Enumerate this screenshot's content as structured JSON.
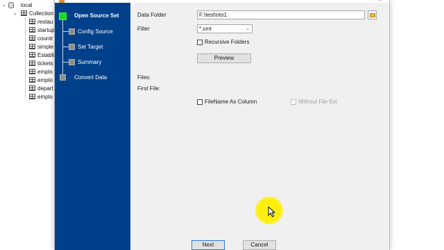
{
  "tree": {
    "root_label": "local",
    "collections_label": "Collection",
    "items": [
      "restau",
      "startup",
      "countr",
      "simple",
      "Establi",
      "tickets",
      "emplo",
      "emplo",
      "depart",
      "emplo"
    ]
  },
  "dialog": {
    "close_glyph": "×"
  },
  "wizard": {
    "steps": [
      {
        "label": "Open Source Set",
        "active": true
      },
      {
        "label": "Config Source",
        "active": false
      },
      {
        "label": "Set Target",
        "active": false
      },
      {
        "label": "Summary",
        "active": false
      },
      {
        "label": "Convert Data",
        "active": false
      }
    ],
    "active_color": "#1ed61e",
    "nav_background": "#00408a"
  },
  "form": {
    "data_folder_label": "Data Folder",
    "data_folder_value": "F:\\test\\nto1",
    "filter_label": "Filter",
    "filter_value": "*.xml",
    "recursive_label": "Recursive Folders",
    "recursive_checked": false,
    "preview_label": "Preview",
    "files_label": "Files:",
    "first_file_label": "First File:",
    "filename_as_column_label": "FileName As Column",
    "filename_as_column_checked": false,
    "without_ext_label": "Without File Ext",
    "without_ext_enabled": false
  },
  "footer": {
    "next_label": "Next",
    "cancel_label": "Cancel"
  },
  "icons": {
    "browse": "folder-icon",
    "dropdown": "chevron-down-icon",
    "cursor": "mouse-cursor-icon"
  }
}
